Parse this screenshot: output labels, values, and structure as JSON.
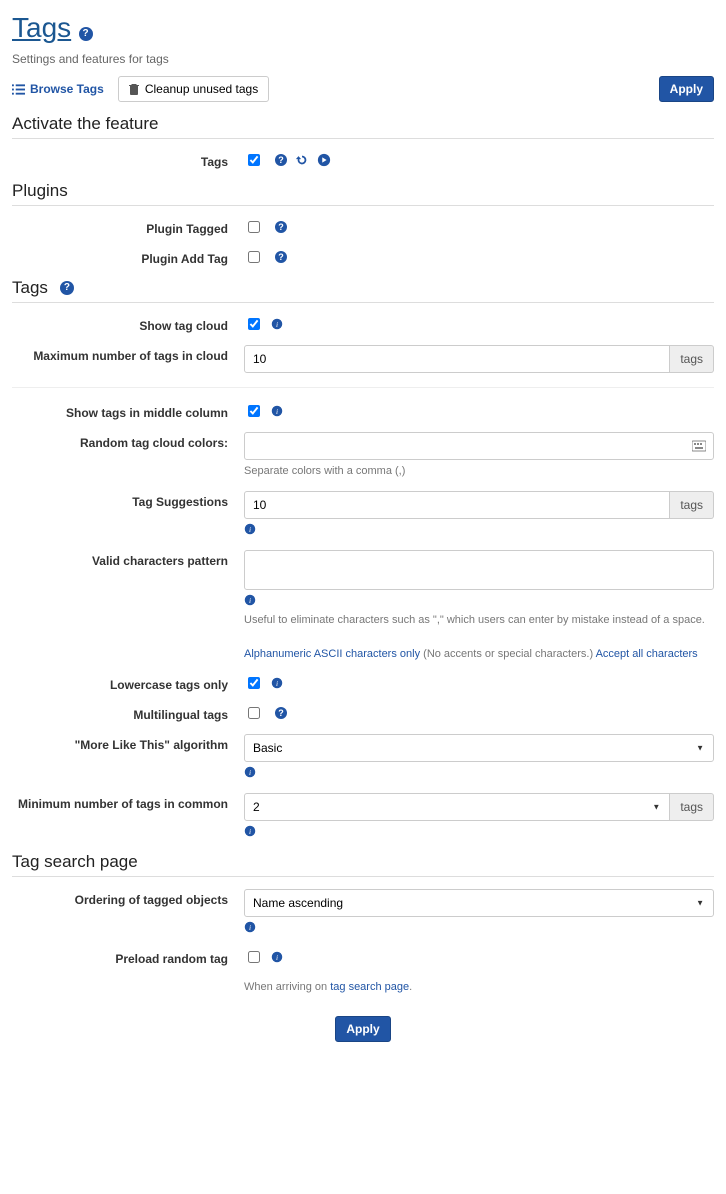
{
  "header": {
    "title": "Tags",
    "subtitle": "Settings and features for tags",
    "browse_tags": "Browse Tags",
    "cleanup_unused": "Cleanup unused tags",
    "apply": "Apply"
  },
  "section_activate": {
    "heading": "Activate the feature",
    "fields": {
      "tags": {
        "label": "Tags",
        "checked": true
      }
    }
  },
  "section_plugins": {
    "heading": "Plugins",
    "fields": {
      "plugin_tagged": {
        "label": "Plugin Tagged",
        "checked": false
      },
      "plugin_add_tag": {
        "label": "Plugin Add Tag",
        "checked": false
      }
    }
  },
  "section_tags": {
    "heading": "Tags",
    "fields": {
      "show_tag_cloud": {
        "label": "Show tag cloud",
        "checked": true
      },
      "max_tags_cloud": {
        "label": "Maximum number of tags in cloud",
        "value": "10",
        "addon": "tags"
      },
      "show_middle": {
        "label": "Show tags in middle column",
        "checked": true
      },
      "random_colors": {
        "label": "Random tag cloud colors:",
        "value": "",
        "help": "Separate colors with a comma (,)"
      },
      "tag_suggestions": {
        "label": "Tag Suggestions",
        "value": "10",
        "addon": "tags"
      },
      "valid_pattern": {
        "label": "Valid characters pattern",
        "value": "",
        "help": "Useful to eliminate characters such as \",\" which users can enter by mistake instead of a space.",
        "link1": "Alphanumeric ASCII characters only",
        "link1_after": "(No accents or special characters.)",
        "link2": "Accept all characters"
      },
      "lowercase_only": {
        "label": "Lowercase tags only",
        "checked": true
      },
      "multilingual": {
        "label": "Multilingual tags",
        "checked": false
      },
      "more_like_this": {
        "label": "\"More Like This\" algorithm",
        "value": "Basic"
      },
      "min_common": {
        "label": "Minimum number of tags in common",
        "value": "2",
        "addon": "tags"
      }
    }
  },
  "section_search": {
    "heading": "Tag search page",
    "fields": {
      "ordering": {
        "label": "Ordering of tagged objects",
        "value": "Name ascending"
      },
      "preload": {
        "label": "Preload random tag",
        "checked": false,
        "help_prefix": "When arriving on ",
        "help_link": "tag search page",
        "help_suffix": "."
      }
    }
  },
  "footer": {
    "apply": "Apply"
  }
}
